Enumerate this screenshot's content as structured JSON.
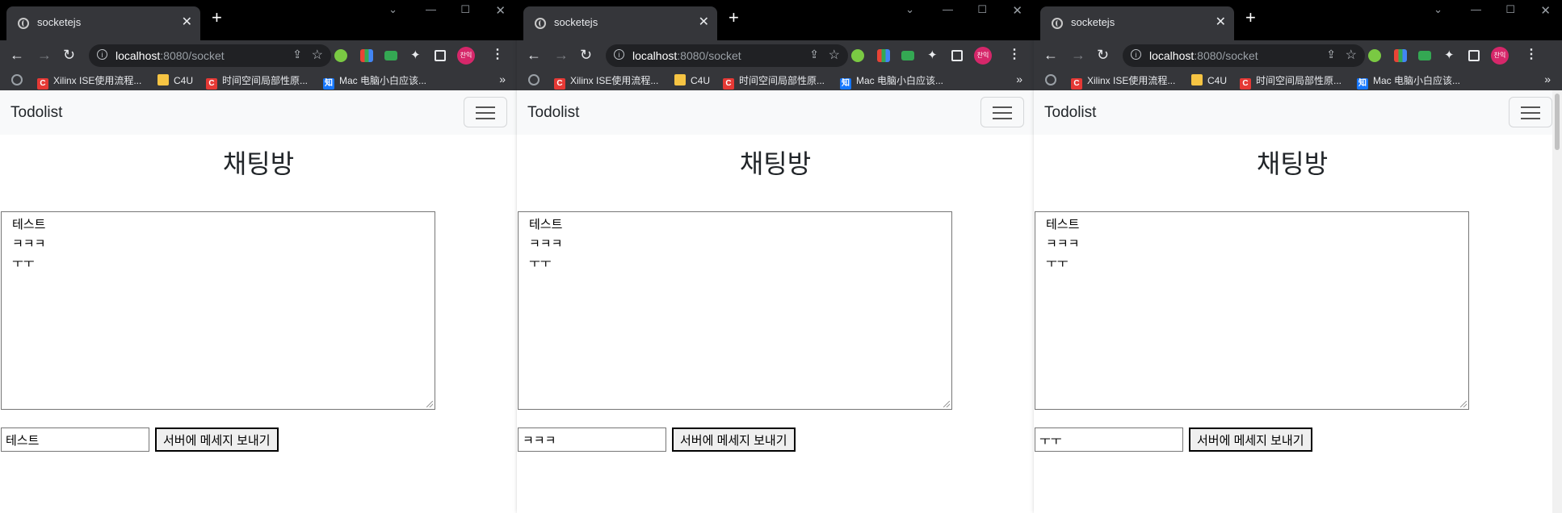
{
  "windows": [
    {
      "tab_title": "socketejs",
      "url_host": "localhost",
      "url_path": ":8080/socket",
      "bookmarks": [
        "Xilinx ISE使用流程...",
        "C4U",
        "时间空间局部性原...",
        "Mac 电脑小白应该..."
      ],
      "brand": "Todolist",
      "heading": "채팅방",
      "chat_lines": [
        "테스트",
        "ㅋㅋㅋ",
        "ㅜㅜ"
      ],
      "input_value": "테스트",
      "send_label": "서버에 메세지 보내기"
    },
    {
      "tab_title": "socketejs",
      "url_host": "localhost",
      "url_path": ":8080/socket",
      "bookmarks": [
        "Xilinx ISE使用流程...",
        "C4U",
        "时间空间局部性原...",
        "Mac 电脑小白应该..."
      ],
      "brand": "Todolist",
      "heading": "채팅방",
      "chat_lines": [
        "테스트",
        "ㅋㅋㅋ",
        "ㅜㅜ"
      ],
      "input_value": "ㅋㅋㅋ",
      "send_label": "서버에 메세지 보내기"
    },
    {
      "tab_title": "socketejs",
      "url_host": "localhost",
      "url_path": ":8080/socket",
      "bookmarks": [
        "Xilinx ISE使用流程...",
        "C4U",
        "时间空间局部性原...",
        "Mac 电脑小白应该..."
      ],
      "brand": "Todolist",
      "heading": "채팅방",
      "chat_lines": [
        "테스트",
        "ㅋㅋㅋ",
        "ㅜㅜ"
      ],
      "input_value": "ㅜㅜ",
      "send_label": "서버에 메세지 보내기"
    }
  ],
  "avatar_text": "찬익",
  "icons": {
    "globe": "globe-icon",
    "close": "close-icon",
    "new_tab": "plus-icon",
    "back": "arrow-left-icon",
    "forward": "arrow-right-icon",
    "reload": "reload-icon",
    "info": "info-icon",
    "share": "share-icon",
    "star": "star-icon",
    "extensions": "puzzle-icon",
    "side_panel": "side-panel-icon",
    "menu": "kebab-menu-icon",
    "hamburger": "hamburger-icon"
  },
  "colors": {
    "chrome_dark": "#35363a",
    "navbar_bg": "#f8f9fa",
    "avatar": "#d6276a"
  }
}
